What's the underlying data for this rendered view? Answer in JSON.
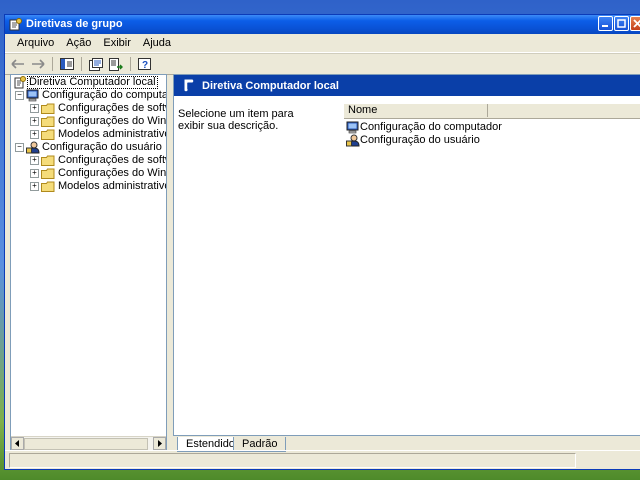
{
  "window": {
    "title": "Diretivas de grupo"
  },
  "menu": [
    "Arquivo",
    "Ação",
    "Exibir",
    "Ajuda"
  ],
  "tree": {
    "root": "Diretiva Computador local",
    "items": [
      {
        "label": "Configuração do computador",
        "expander": "−"
      },
      {
        "label": "Configurações de software",
        "expander": "+"
      },
      {
        "label": "Configurações do Windows",
        "expander": "+"
      },
      {
        "label": "Modelos administrativos",
        "expander": "+"
      },
      {
        "label": "Configuração do usuário",
        "expander": "−"
      },
      {
        "label": "Configurações de software",
        "expander": "+"
      },
      {
        "label": "Configurações do Windows",
        "expander": "+"
      },
      {
        "label": "Modelos administrativos",
        "expander": "+"
      }
    ]
  },
  "details": {
    "header": "Diretiva Computador local",
    "description": "Selecione um item para exibir sua descrição.",
    "column": "Nome",
    "items": [
      "Configuração do computador",
      "Configuração do usuário"
    ]
  },
  "tabs": [
    "Estendido",
    "Padrão"
  ],
  "colors": {
    "titlebar": "#0a52d6",
    "panel_header": "#0a3fa8",
    "selection_box": "#000000"
  }
}
